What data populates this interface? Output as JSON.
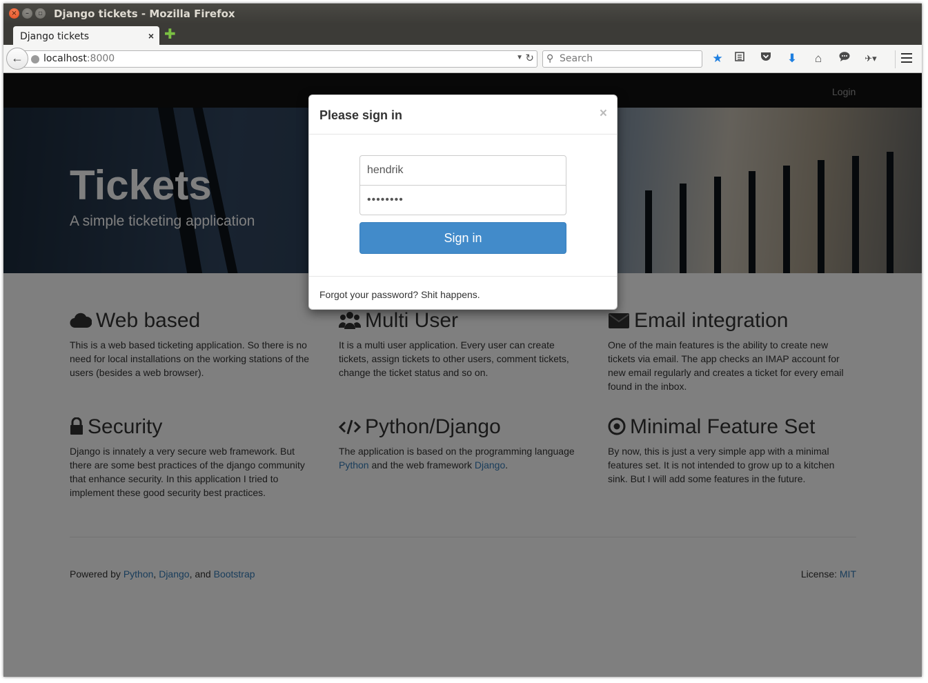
{
  "window": {
    "title": "Django tickets - Mozilla Firefox"
  },
  "tabs": [
    {
      "label": "Django tickets",
      "close": "×"
    }
  ],
  "newtab": "✚",
  "navbar": {
    "url_host": "localhost",
    "url_port": ":8000",
    "search_placeholder": "Search",
    "icons": [
      "back-icon",
      "reload-icon",
      "search-icon",
      "bookmark-star-icon",
      "reading-list-icon",
      "pocket-icon",
      "downloads-icon",
      "home-icon",
      "chat-icon",
      "extension-icon",
      "menu-icon"
    ]
  },
  "site": {
    "nav_login": "Login",
    "hero": {
      "title": "Tickets",
      "subtitle": "A simple ticketing application"
    },
    "features": [
      {
        "icon": "cloud-icon",
        "title": "Web based",
        "text": "This is a web based ticketing application. So there is no need for local installations on the working stations of the users (besides a web browser)."
      },
      {
        "icon": "users-icon",
        "title": "Multi User",
        "text": "It is a multi user application. Every user can create tickets, assign tickets to other users, comment tickets, change the ticket status and so on."
      },
      {
        "icon": "envelope-icon",
        "title": "Email integration",
        "text": "One of the main features is the ability to create new tickets via email. The app checks an IMAP account for new email regularly and creates a ticket for every email found in the inbox."
      },
      {
        "icon": "lock-icon",
        "title": "Security",
        "text": "Django is innately a very secure web framework. But there are some best practices of the django community that enhance security. In this application I tried to implement these good security best practices."
      },
      {
        "icon": "code-icon",
        "title": "Python/Django",
        "text_before": "The application is based on the programming language ",
        "link1": "Python",
        "text_mid": " and the web framework ",
        "link2": "Django",
        "text_after": "."
      },
      {
        "icon": "bullseye-icon",
        "title": "Minimal Feature Set",
        "text": "By now, this is just a very simple app with a minimal features set. It is not intended to grow up to a kitchen sink. But I will add some features in the future."
      }
    ],
    "footer": {
      "powered_prefix": "Powered by ",
      "link_python": "Python",
      "sep1": ", ",
      "link_django": "Django",
      "sep2": ", and ",
      "link_bootstrap": "Bootstrap",
      "license_prefix": "License: ",
      "link_license": "MIT"
    }
  },
  "modal": {
    "title": "Please sign in",
    "close": "×",
    "username_value": "hendrik",
    "password_value": "••••••••",
    "signin_label": "Sign in",
    "forgot_text": "Forgot your password? Shit happens."
  },
  "colors": {
    "primary": "#428bca",
    "link": "#337ab7",
    "navbar": "#101010"
  }
}
